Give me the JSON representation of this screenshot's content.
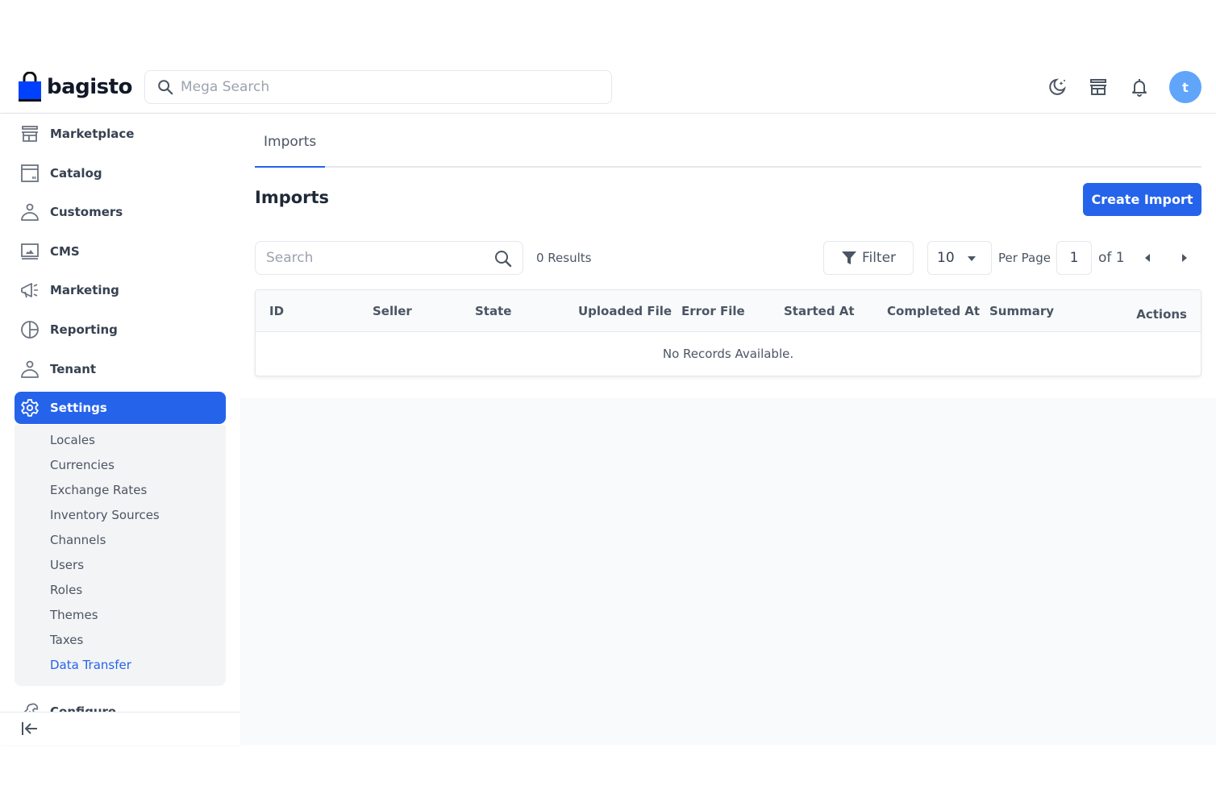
{
  "header": {
    "logo_text": "bagisto",
    "mega_search_placeholder": "Mega Search",
    "avatar_initial": "t",
    "icons": [
      "dark-mode-icon",
      "storefront-icon",
      "notification-bell-icon"
    ]
  },
  "sidebar": {
    "items": [
      {
        "label": "Marketplace",
        "icon": "storefront-icon"
      },
      {
        "label": "Catalog",
        "icon": "catalog-icon"
      },
      {
        "label": "Customers",
        "icon": "user-icon"
      },
      {
        "label": "CMS",
        "icon": "cms-monitor-icon"
      },
      {
        "label": "Marketing",
        "icon": "megaphone-icon"
      },
      {
        "label": "Reporting",
        "icon": "pie-chart-icon"
      },
      {
        "label": "Tenant",
        "icon": "user-icon"
      },
      {
        "label": "Settings",
        "icon": "gear-icon",
        "active": true
      }
    ],
    "settings_sub": [
      {
        "label": "Locales"
      },
      {
        "label": "Currencies"
      },
      {
        "label": "Exchange Rates"
      },
      {
        "label": "Inventory Sources"
      },
      {
        "label": "Channels"
      },
      {
        "label": "Users"
      },
      {
        "label": "Roles"
      },
      {
        "label": "Themes"
      },
      {
        "label": "Taxes"
      },
      {
        "label": "Data Transfer",
        "active": true
      }
    ],
    "configure": {
      "label": "Configure",
      "icon": "wrench-icon"
    },
    "collapse_icon": "collapse-sidebar-icon"
  },
  "main": {
    "tabs": [
      {
        "label": "Imports",
        "active": true
      }
    ],
    "page_title": "Imports",
    "create_button": "Create Import",
    "search_placeholder": "Search",
    "results": "0 Results",
    "filter_label": "Filter",
    "per_page_value": "10",
    "per_page_label": "Per Page",
    "current_page": "1",
    "of_pages": "of 1",
    "table": {
      "columns": [
        "ID",
        "Seller",
        "State",
        "Uploaded File",
        "Error File",
        "Started At",
        "Completed At",
        "Summary",
        "Actions"
      ],
      "empty_message": "No Records Available."
    }
  },
  "colors": {
    "accent": "#2563eb",
    "avatar": "#60a5fa",
    "text": "#374151",
    "muted": "#9ca3af",
    "border": "#e5e7eb",
    "page_bg": "#f9fafb"
  }
}
